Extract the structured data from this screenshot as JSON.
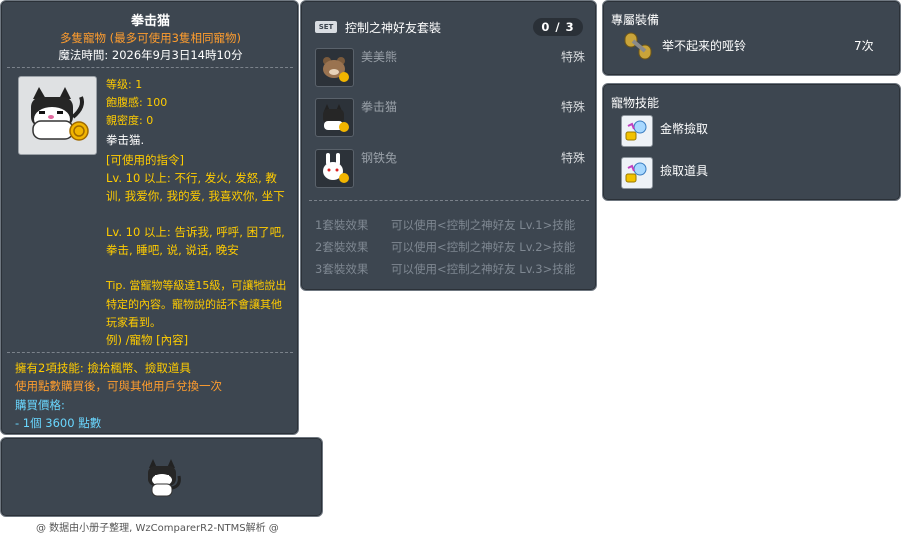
{
  "item_id": "05000601",
  "item": {
    "name": "拳击猫",
    "subtitle": "多隻寵物 (最多可使用3隻相同寵物)",
    "expire": "魔法時間: 2026年9月3日14時10分",
    "level": "等级: 1",
    "fullness": "飽腹感: 100",
    "closeness": "親密度: 0",
    "desc": "拳击猫.",
    "commands_header": "[可使用的指令]",
    "cmd1": "Lv. 10 以上: 不行, 发火, 发怒, 教训, 我爱你, 我的爱, 我喜欢你, 坐下",
    "cmd2": "Lv. 10 以上: 告诉我, 呼呼, 困了吧, 拳击, 睡吧, 说, 说话, 晚安",
    "tip": "Tip. 當寵物等級達15級，可讓牠說出特定的內容。寵物說的話不會讓其他玩家看到。",
    "example": "例) /寵物 [內容]",
    "skills_line": "擁有2項技能: 撿拾楓幣、撿取道具",
    "exchange_line": "使用點數購買後，可與其他用戶兌換一次",
    "price_label": "購買價格:",
    "price_value": " - 1個 3600 點數"
  },
  "set": {
    "badge": "SET",
    "name": "控制之神好友套裝",
    "count": "0 / 3",
    "items": [
      {
        "name": "美美熊",
        "tag": "特殊"
      },
      {
        "name": "拳击猫",
        "tag": "特殊"
      },
      {
        "name": "钢铁兔",
        "tag": "特殊"
      }
    ],
    "bonuses": [
      {
        "label": "1套裝效果",
        "effect": "可以使用<控制之神好友 Lv.1>技能"
      },
      {
        "label": "2套裝效果",
        "effect": "可以使用<控制之神好友 Lv.2>技能"
      },
      {
        "label": "3套裝效果",
        "effect": "可以使用<控制之神好友 Lv.3>技能"
      }
    ]
  },
  "equip": {
    "title": "專屬裝備",
    "name": "举不起来的哑铃",
    "count": "7次"
  },
  "skills": {
    "title": "寵物技能",
    "items": [
      {
        "name": "金幣撿取",
        "icon": "coin-pickup-icon"
      },
      {
        "name": "撿取道具",
        "icon": "item-pickup-icon"
      }
    ]
  },
  "footer": "@ 数据由小册子整理, WzComparerR2-NTMS解析 @",
  "colors": {
    "panel_bg": "#3d4650",
    "orange": "#ff9d2e",
    "yellow": "#ffcc00",
    "cyan": "#6ad7ff",
    "gray_text": "#7f8892"
  }
}
